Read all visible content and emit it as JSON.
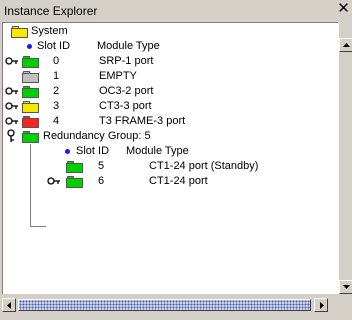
{
  "window": {
    "title": "Instance Explorer",
    "close_glyph": "✕"
  },
  "tree": {
    "root_label": "System",
    "header_slot": "Slot ID",
    "header_type": "Module Type",
    "slots": [
      {
        "id": "0",
        "type": "SRP-1 port",
        "color": "#00d000",
        "expandable": true
      },
      {
        "id": "1",
        "type": "EMPTY",
        "color": "#c0c0c0",
        "expandable": false
      },
      {
        "id": "2",
        "type": "OC3-2 port",
        "color": "#00d000",
        "expandable": true
      },
      {
        "id": "3",
        "type": "CT3-3 port",
        "color": "#f5e800",
        "expandable": true
      },
      {
        "id": "4",
        "type": "T3 FRAME-3 port",
        "color": "#ff2020",
        "expandable": true
      }
    ],
    "redundancy": {
      "label": "Redundancy Group: 5",
      "header_slot": "Slot ID",
      "header_type": "Module Type",
      "children": [
        {
          "id": "5",
          "type": "CT1-24 port (Standby)",
          "color": "#00d000",
          "expandable": false
        },
        {
          "id": "6",
          "type": "CT1-24 port",
          "color": "#00d000",
          "expandable": true
        }
      ]
    }
  },
  "colors": {
    "folder_root": "#ffe800",
    "folder_green": "#00d000",
    "folder_gray": "#c0c0c0",
    "folder_yellow": "#f5e800",
    "folder_red": "#ff2020",
    "bullet": "#1a1aff"
  }
}
